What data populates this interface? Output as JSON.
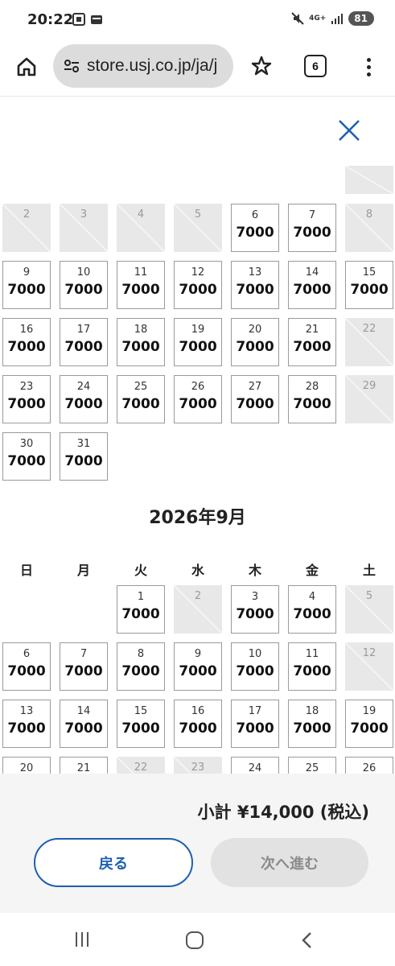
{
  "status": {
    "time": "20:22",
    "network": "4G+",
    "battery": "81"
  },
  "browser": {
    "url": "store.usj.co.jp/ja/j",
    "tab_count": "6"
  },
  "prev_month": {
    "disabled": [
      {
        "row": 0,
        "col": 6,
        "day": ""
      },
      {
        "row": 1,
        "col": 0,
        "day": "2"
      },
      {
        "row": 1,
        "col": 1,
        "day": "3"
      },
      {
        "row": 1,
        "col": 2,
        "day": "4"
      },
      {
        "row": 1,
        "col": 3,
        "day": "5"
      },
      {
        "row": 1,
        "col": 6,
        "day": "8"
      },
      {
        "row": 3,
        "col": 6,
        "day": "22"
      },
      {
        "row": 4,
        "col": 6,
        "day": "29"
      }
    ],
    "available": [
      {
        "row": 1,
        "col": 4,
        "day": "6",
        "price": "7000"
      },
      {
        "row": 1,
        "col": 5,
        "day": "7",
        "price": "7000"
      },
      {
        "row": 2,
        "col": 0,
        "day": "9",
        "price": "7000"
      },
      {
        "row": 2,
        "col": 1,
        "day": "10",
        "price": "7000"
      },
      {
        "row": 2,
        "col": 2,
        "day": "11",
        "price": "7000"
      },
      {
        "row": 2,
        "col": 3,
        "day": "12",
        "price": "7000"
      },
      {
        "row": 2,
        "col": 4,
        "day": "13",
        "price": "7000"
      },
      {
        "row": 2,
        "col": 5,
        "day": "14",
        "price": "7000"
      },
      {
        "row": 2,
        "col": 6,
        "day": "15",
        "price": "7000"
      },
      {
        "row": 3,
        "col": 0,
        "day": "16",
        "price": "7000"
      },
      {
        "row": 3,
        "col": 1,
        "day": "17",
        "price": "7000"
      },
      {
        "row": 3,
        "col": 2,
        "day": "18",
        "price": "7000"
      },
      {
        "row": 3,
        "col": 3,
        "day": "19",
        "price": "7000"
      },
      {
        "row": 3,
        "col": 4,
        "day": "20",
        "price": "7000"
      },
      {
        "row": 3,
        "col": 5,
        "day": "21",
        "price": "7000"
      },
      {
        "row": 4,
        "col": 0,
        "day": "23",
        "price": "7000"
      },
      {
        "row": 4,
        "col": 1,
        "day": "24",
        "price": "7000"
      },
      {
        "row": 4,
        "col": 2,
        "day": "25",
        "price": "7000"
      },
      {
        "row": 4,
        "col": 3,
        "day": "26",
        "price": "7000"
      },
      {
        "row": 4,
        "col": 4,
        "day": "27",
        "price": "7000"
      },
      {
        "row": 4,
        "col": 5,
        "day": "28",
        "price": "7000"
      },
      {
        "row": 5,
        "col": 0,
        "day": "30",
        "price": "7000"
      },
      {
        "row": 5,
        "col": 1,
        "day": "31",
        "price": "7000"
      }
    ]
  },
  "month": {
    "title": "2026年9月",
    "weekdays": [
      "日",
      "月",
      "火",
      "水",
      "木",
      "金",
      "土"
    ],
    "disabled": [
      {
        "row": 0,
        "col": 3,
        "day": "2"
      },
      {
        "row": 0,
        "col": 6,
        "day": "5"
      },
      {
        "row": 1,
        "col": 6,
        "day": "12"
      },
      {
        "row": 3,
        "col": 2,
        "day": "22"
      },
      {
        "row": 3,
        "col": 3,
        "day": "23"
      }
    ],
    "available": [
      {
        "row": 0,
        "col": 2,
        "day": "1",
        "price": "7000"
      },
      {
        "row": 0,
        "col": 4,
        "day": "3",
        "price": "7000"
      },
      {
        "row": 0,
        "col": 5,
        "day": "4",
        "price": "7000"
      },
      {
        "row": 1,
        "col": 0,
        "day": "6",
        "price": "7000"
      },
      {
        "row": 1,
        "col": 1,
        "day": "7",
        "price": "7000"
      },
      {
        "row": 1,
        "col": 2,
        "day": "8",
        "price": "7000"
      },
      {
        "row": 1,
        "col": 3,
        "day": "9",
        "price": "7000"
      },
      {
        "row": 1,
        "col": 4,
        "day": "10",
        "price": "7000"
      },
      {
        "row": 1,
        "col": 5,
        "day": "11",
        "price": "7000"
      },
      {
        "row": 2,
        "col": 0,
        "day": "13",
        "price": "7000"
      },
      {
        "row": 2,
        "col": 1,
        "day": "14",
        "price": "7000"
      },
      {
        "row": 2,
        "col": 2,
        "day": "15",
        "price": "7000"
      },
      {
        "row": 2,
        "col": 3,
        "day": "16",
        "price": "7000"
      },
      {
        "row": 2,
        "col": 4,
        "day": "17",
        "price": "7000"
      },
      {
        "row": 2,
        "col": 5,
        "day": "18",
        "price": "7000"
      },
      {
        "row": 2,
        "col": 6,
        "day": "19",
        "price": "7000"
      },
      {
        "row": 3,
        "col": 0,
        "day": "20",
        "price": ""
      },
      {
        "row": 3,
        "col": 1,
        "day": "21",
        "price": ""
      },
      {
        "row": 3,
        "col": 4,
        "day": "24",
        "price": ""
      },
      {
        "row": 3,
        "col": 5,
        "day": "25",
        "price": ""
      },
      {
        "row": 3,
        "col": 6,
        "day": "26",
        "price": ""
      }
    ]
  },
  "footer": {
    "subtotal": "小計 ¥14,000 (税込)",
    "back_label": "戻る",
    "next_label": "次へ進む"
  },
  "colors": {
    "accent": "#1d5fb0",
    "disabled_fill": "#e8e8e8",
    "cell_border": "#9a9a9a"
  }
}
